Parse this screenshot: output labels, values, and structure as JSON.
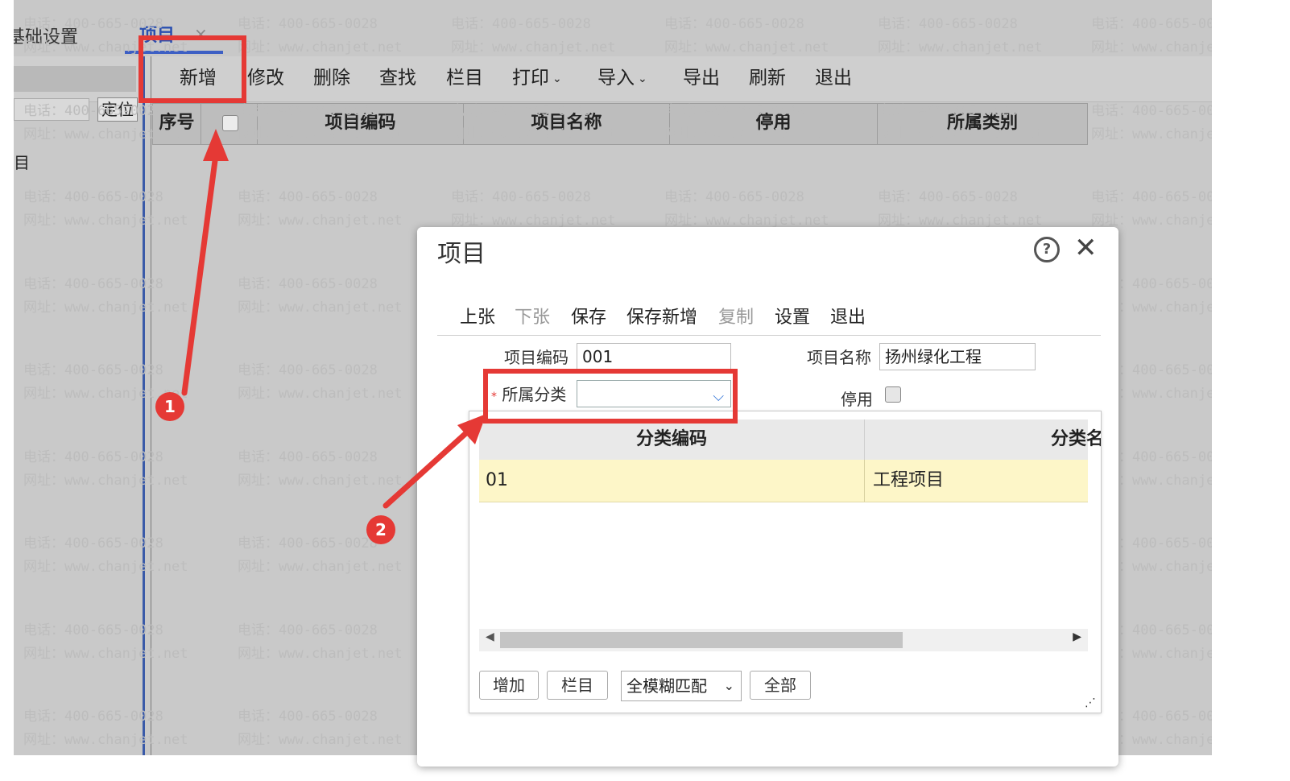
{
  "tabs": {
    "base_label": "基础设置",
    "project_label": "项目",
    "close_glyph": "×"
  },
  "toolbar": {
    "new": "新增",
    "edit": "修改",
    "delete": "删除",
    "find": "查找",
    "columns": "栏目",
    "print": "打印",
    "import": "导入",
    "export": "导出",
    "refresh": "刷新",
    "exit": "退出",
    "chevron": "⌄"
  },
  "left_panel": {
    "search_value": "",
    "locate_button": "定位",
    "tree_item": "目"
  },
  "grid": {
    "headers": [
      "序号",
      "项目编码",
      "项目名称",
      "停用",
      "所属类别"
    ]
  },
  "watermark": {
    "phone": "电话：400-665-0028",
    "site": "网址：www.chanjet.net"
  },
  "annotations": {
    "step1": "1",
    "step2": "2"
  },
  "dialog": {
    "title": "项目",
    "help_glyph": "?",
    "close_glyph": "✕",
    "toolbar": {
      "prev": "上张",
      "next": "下张",
      "save": "保存",
      "save_new": "保存新增",
      "copy": "复制",
      "settings": "设置",
      "exit": "退出"
    },
    "fields": {
      "code_label": "项目编码",
      "code_value": "001",
      "name_label": "项目名称",
      "name_value": "扬州绿化工程",
      "category_label": "所属分类",
      "category_required": "*",
      "category_value": "",
      "stop_label": "停用"
    },
    "dropdown": {
      "headers": [
        "分类编码",
        "分类名称"
      ],
      "rows": [
        {
          "code": "01",
          "name": "工程项目"
        }
      ],
      "buttons": {
        "add": "增加",
        "columns": "栏目",
        "all": "全部"
      },
      "match_mode": "全模糊匹配",
      "scroll_left": "◀",
      "scroll_right": "▶"
    }
  },
  "colors": {
    "accent": "#3d5fc4",
    "highlight_row": "#fdf6c8",
    "annotation_red": "#e53935"
  }
}
